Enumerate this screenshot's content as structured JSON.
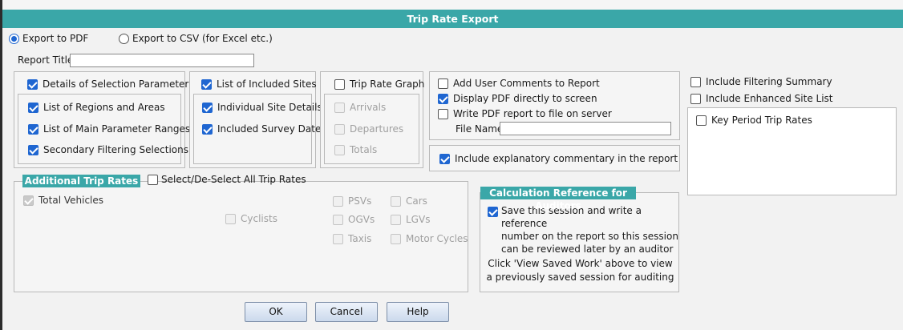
{
  "dialog": {
    "title": "Trip Rate Export"
  },
  "export_format": {
    "pdf_label": "Export to PDF",
    "csv_label": "Export to CSV (for Excel etc.)",
    "selected": "pdf"
  },
  "report_title": {
    "label": "Report Title",
    "value": ""
  },
  "selection_group": {
    "header": {
      "label": "Details of Selection Parameters",
      "checked": true
    },
    "items": [
      {
        "label": "List of Regions and Areas",
        "checked": true
      },
      {
        "label": "List of Main Parameter Ranges",
        "checked": true
      },
      {
        "label": "Secondary Filtering Selections",
        "checked": true
      }
    ]
  },
  "sites_group": {
    "header": {
      "label": "List of Included Sites",
      "checked": true
    },
    "items": [
      {
        "label": "Individual Site Details",
        "checked": true
      },
      {
        "label": "Included Survey Dates",
        "checked": true
      }
    ]
  },
  "graph_group": {
    "header": {
      "label": "Trip Rate Graph",
      "checked": false
    },
    "items": [
      {
        "label": "Arrivals",
        "checked": false,
        "disabled": true
      },
      {
        "label": "Departures",
        "checked": false,
        "disabled": true
      },
      {
        "label": "Totals",
        "checked": false,
        "disabled": true
      }
    ]
  },
  "report_options": {
    "add_comments": {
      "label": "Add User Comments to Report",
      "checked": false
    },
    "display_pdf": {
      "label": "Display PDF directly to screen",
      "checked": true
    },
    "write_pdf": {
      "label": "Write PDF report to file on server",
      "checked": false
    },
    "file_name_label": "File Name",
    "file_name_value": ""
  },
  "commentary": {
    "label": "Include explanatory commentary in the report",
    "checked": true
  },
  "right_options": {
    "filtering_summary": {
      "label": "Include Filtering Summary",
      "checked": false
    },
    "enhanced_site_list": {
      "label": "Include Enhanced Site List",
      "checked": false
    },
    "key_period": {
      "label": "Key Period Trip Rates",
      "checked": false
    }
  },
  "additional_trip_rates": {
    "header": "Additional Trip Rates",
    "select_all_label": "Select/De-Select All Trip Rates",
    "select_all_checked": false,
    "total_vehicles": "Total Vehicles",
    "cyclists": "Cyclists",
    "psvs": "PSVs",
    "ogvs": "OGVs",
    "taxis": "Taxis",
    "cars": "Cars",
    "lgvs": "LGVs",
    "motor_cycles": "Motor Cycles"
  },
  "auditors": {
    "header": "Calculation Reference for Auditors",
    "save_lines": [
      "Save this session and write a reference",
      "number on the report so this session",
      "can be reviewed later by an auditor"
    ],
    "save_checked": true,
    "note_lines": [
      "Click 'View Saved Work' above to view",
      "a previously saved session for auditing"
    ]
  },
  "buttons": {
    "ok": "OK",
    "cancel": "Cancel",
    "help": "Help"
  }
}
